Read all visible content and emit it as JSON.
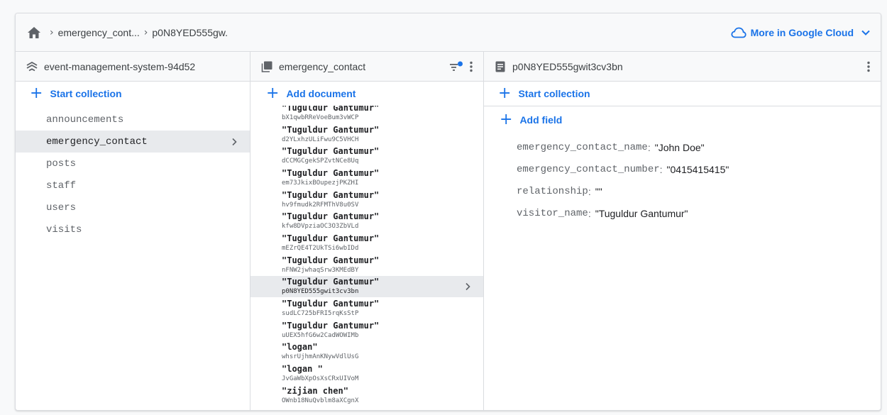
{
  "breadcrumb": {
    "collection": "emergency_cont...",
    "document": "p0N8YED555gw."
  },
  "cloud_link": {
    "label": "More in Google Cloud"
  },
  "colors": {
    "accent": "#1a73e8",
    "selected_bg": "#e8eaed",
    "text": "#3c4043"
  },
  "root_panel": {
    "title": "event-management-system-94d52",
    "start_collection": "Start collection",
    "collections": [
      "announcements",
      "emergency_contact",
      "posts",
      "staff",
      "users",
      "visits"
    ],
    "selected_index": 1
  },
  "collection_panel": {
    "title": "emergency_contact",
    "add_document": "Add document",
    "documents": [
      {
        "name": "\"Tuguldur Gantumur\"",
        "id": "bX1qwbRReVoeBum3vWCP"
      },
      {
        "name": "\"Tuguldur Gantumur\"",
        "id": "d2YLxhzULiFwu9C5VHCH"
      },
      {
        "name": "\"Tuguldur Gantumur\"",
        "id": "dCCMGCgekSPZvtNCe8Uq"
      },
      {
        "name": "\"Tuguldur Gantumur\"",
        "id": "em73JkixBOupezjPKZHI"
      },
      {
        "name": "\"Tuguldur Gantumur\"",
        "id": "hv9fmudk2RFMThV8u0SV"
      },
      {
        "name": "\"Tuguldur Gantumur\"",
        "id": "kfw8DVpziaOC3O3ZbVLd"
      },
      {
        "name": "\"Tuguldur Gantumur\"",
        "id": "mEZrQE4T2UkTSi6wbIDd"
      },
      {
        "name": "\"Tuguldur Gantumur\"",
        "id": "nFNW2jwhaqSrw3KMEdBY"
      },
      {
        "name": "\"Tuguldur Gantumur\"",
        "id": "p0N8YED555gwit3cv3bn"
      },
      {
        "name": "\"Tuguldur Gantumur\"",
        "id": "sudLC725bFRI5rqKsStP"
      },
      {
        "name": "\"Tuguldur Gantumur\"",
        "id": "uUEX5hfG6w2CadWOWIMb"
      },
      {
        "name": "\"logan\"",
        "id": "whsrUjhmAnKNywVdlUsG"
      },
      {
        "name": "\"logan \"",
        "id": "JvGaWbXpOsXsCRxUIVoM"
      },
      {
        "name": "\"zijian chen\"",
        "id": "OWnb18NuQvblm8aXCgnX"
      }
    ],
    "selected_index": 8
  },
  "document_panel": {
    "title": "p0N8YED555gwit3cv3bn",
    "start_collection": "Start collection",
    "add_field": "Add field",
    "fields": [
      {
        "key": "emergency_contact_name",
        "value": "\"John Doe\""
      },
      {
        "key": "emergency_contact_number",
        "value": "\"0415415415\""
      },
      {
        "key": "relationship",
        "value": "\"\""
      },
      {
        "key": "visitor_name",
        "value": "\"Tuguldur Gantumur\""
      }
    ]
  }
}
